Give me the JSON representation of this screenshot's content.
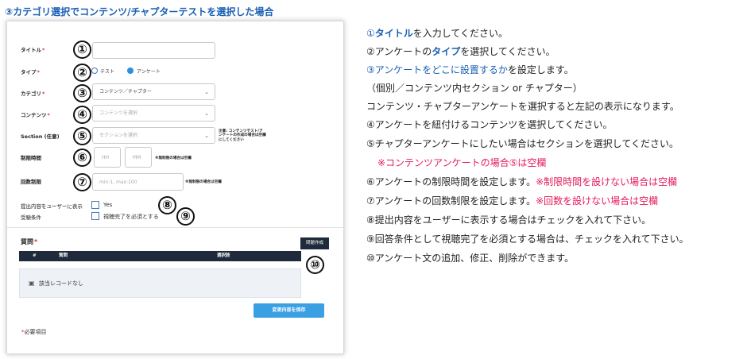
{
  "heading": "③カテゴリ選択でコンテンツ/チャプターテストを選択した場合",
  "form": {
    "title_label": "タイトル",
    "required_mark": "*",
    "type_label": "タイプ",
    "type_option_test": "テスト",
    "type_option_survey": "アンケート",
    "category_label": "カテゴリ",
    "category_value": "コンテンツ／チャプター",
    "content_label": "コンテンツ",
    "content_placeholder": "コンテンツを選択",
    "section_label": "Section (任意)",
    "section_placeholder": "セクションを選択",
    "section_note": "注意: コンテンツテスト/アンケートの作成の場合は空欄にしてください",
    "time_limit_label": "制限時間",
    "hh_placeholder": "HH",
    "mm_placeholder": "MM",
    "time_note": "※無制限の場合は空欄",
    "count_label": "回数制限",
    "count_placeholder": "min:1, max:100",
    "count_note": "※無制限の場合は空欄",
    "show_to_user_label": "提出内容をユーザーに表示",
    "show_to_user_value": "Yes",
    "answer_condition_label": "受験条件",
    "answer_condition_value": "視聴完了を必須とする",
    "questions_label": "質問",
    "create_question_button": "問題作成",
    "col_no": "#",
    "col_question": "質問",
    "col_choices": "選択肢",
    "no_records": "該当レコードなし",
    "save_button": "変更内容を保存",
    "required_note": "必要項目"
  },
  "markers": [
    "①",
    "②",
    "③",
    "④",
    "⑤",
    "⑥",
    "⑦",
    "⑧",
    "⑨",
    "⑩"
  ],
  "instructions": {
    "l1_a": "①",
    "l1_b": "タイトル",
    "l1_c": "を入力してください。",
    "l2_a": "②アンケートの",
    "l2_b": "タイプ",
    "l2_c": "を選択してください。",
    "l3_a": "③アンケートをどこに設置するか",
    "l3_b": "を設定します。",
    "l4": "（個別／コンテンツ内セクション or チャプター）",
    "l5": "コンテンツ・チャプターアンケートを選択すると左記の表示になります。",
    "l6": "④アンケートを紐付けるコンテンツを選択してください。",
    "l7": "⑤チャプターアンケートにしたい場合はセクションを選択してください。",
    "l8": "※コンテンツアンケートの場合⑤は空欄",
    "l9_a": "⑥アンケートの制限時間を設定します。",
    "l9_b": "※制限時間を設けない場合は空欄",
    "l10_a": "⑦アンケートの回数制限を設定します。",
    "l10_b": "※回数を設けない場合は空欄",
    "l11": "⑧提出内容をユーザーに表示する場合はチェックを入れて下さい。",
    "l12": "⑨回答条件として視聴完了を必須とする場合は、チェックを入れて下さい。",
    "l13": "⑩アンケート文の追加、修正、削除ができます。"
  },
  "colors": {
    "accent": "#1a5fb4",
    "save": "#3aa0e4",
    "alert": "#e6195a",
    "header_dark": "#1f2a3c"
  }
}
